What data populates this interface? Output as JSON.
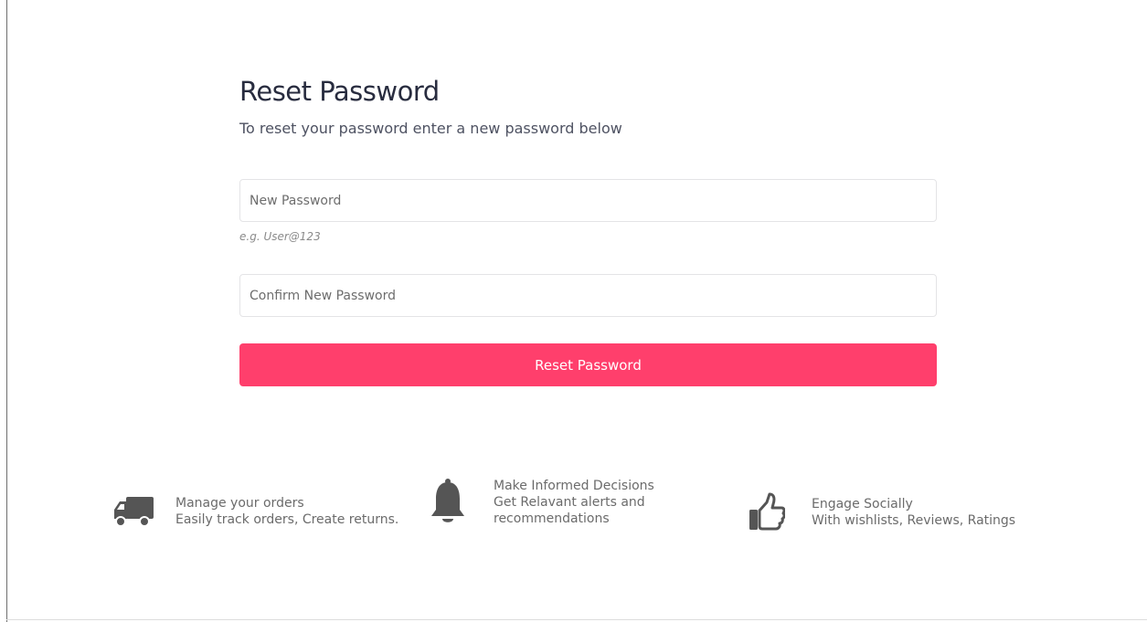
{
  "page": {
    "title": "Reset Password",
    "subtitle": "To reset your password enter a new password below"
  },
  "form": {
    "new_password_placeholder": "New Password",
    "new_password_hint": "e.g. User@123",
    "confirm_password_placeholder": "Confirm New Password",
    "submit_label": "Reset Password",
    "accent_color": "#ff3f6c"
  },
  "features": [
    {
      "icon": "truck-icon",
      "title": "Manage your orders",
      "lines": [
        "Easily track orders, Create returns."
      ]
    },
    {
      "icon": "bell-icon",
      "title": "Make Informed Decisions",
      "lines": [
        "Get Relavant alerts and",
        "recommendations"
      ]
    },
    {
      "icon": "thumbs-up-icon",
      "title": "Engage Socially",
      "lines": [
        "With wishlists, Reviews, Ratings"
      ]
    }
  ]
}
